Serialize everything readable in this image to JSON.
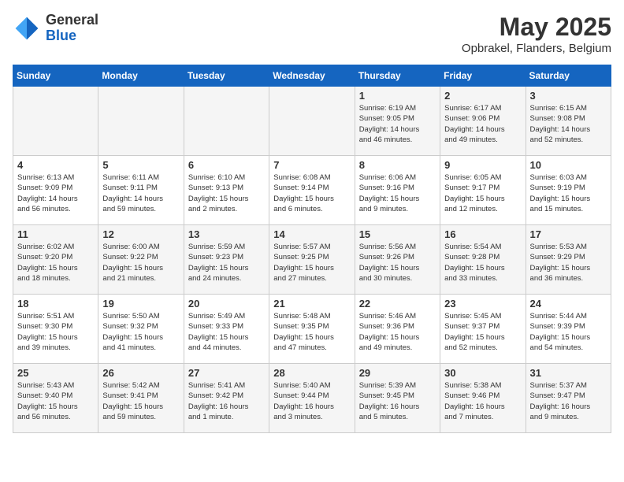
{
  "header": {
    "logo_line1": "General",
    "logo_line2": "Blue",
    "month": "May 2025",
    "location": "Opbrakel, Flanders, Belgium"
  },
  "weekdays": [
    "Sunday",
    "Monday",
    "Tuesday",
    "Wednesday",
    "Thursday",
    "Friday",
    "Saturday"
  ],
  "weeks": [
    [
      {
        "day": "",
        "info": ""
      },
      {
        "day": "",
        "info": ""
      },
      {
        "day": "",
        "info": ""
      },
      {
        "day": "",
        "info": ""
      },
      {
        "day": "1",
        "info": "Sunrise: 6:19 AM\nSunset: 9:05 PM\nDaylight: 14 hours\nand 46 minutes."
      },
      {
        "day": "2",
        "info": "Sunrise: 6:17 AM\nSunset: 9:06 PM\nDaylight: 14 hours\nand 49 minutes."
      },
      {
        "day": "3",
        "info": "Sunrise: 6:15 AM\nSunset: 9:08 PM\nDaylight: 14 hours\nand 52 minutes."
      }
    ],
    [
      {
        "day": "4",
        "info": "Sunrise: 6:13 AM\nSunset: 9:09 PM\nDaylight: 14 hours\nand 56 minutes."
      },
      {
        "day": "5",
        "info": "Sunrise: 6:11 AM\nSunset: 9:11 PM\nDaylight: 14 hours\nand 59 minutes."
      },
      {
        "day": "6",
        "info": "Sunrise: 6:10 AM\nSunset: 9:13 PM\nDaylight: 15 hours\nand 2 minutes."
      },
      {
        "day": "7",
        "info": "Sunrise: 6:08 AM\nSunset: 9:14 PM\nDaylight: 15 hours\nand 6 minutes."
      },
      {
        "day": "8",
        "info": "Sunrise: 6:06 AM\nSunset: 9:16 PM\nDaylight: 15 hours\nand 9 minutes."
      },
      {
        "day": "9",
        "info": "Sunrise: 6:05 AM\nSunset: 9:17 PM\nDaylight: 15 hours\nand 12 minutes."
      },
      {
        "day": "10",
        "info": "Sunrise: 6:03 AM\nSunset: 9:19 PM\nDaylight: 15 hours\nand 15 minutes."
      }
    ],
    [
      {
        "day": "11",
        "info": "Sunrise: 6:02 AM\nSunset: 9:20 PM\nDaylight: 15 hours\nand 18 minutes."
      },
      {
        "day": "12",
        "info": "Sunrise: 6:00 AM\nSunset: 9:22 PM\nDaylight: 15 hours\nand 21 minutes."
      },
      {
        "day": "13",
        "info": "Sunrise: 5:59 AM\nSunset: 9:23 PM\nDaylight: 15 hours\nand 24 minutes."
      },
      {
        "day": "14",
        "info": "Sunrise: 5:57 AM\nSunset: 9:25 PM\nDaylight: 15 hours\nand 27 minutes."
      },
      {
        "day": "15",
        "info": "Sunrise: 5:56 AM\nSunset: 9:26 PM\nDaylight: 15 hours\nand 30 minutes."
      },
      {
        "day": "16",
        "info": "Sunrise: 5:54 AM\nSunset: 9:28 PM\nDaylight: 15 hours\nand 33 minutes."
      },
      {
        "day": "17",
        "info": "Sunrise: 5:53 AM\nSunset: 9:29 PM\nDaylight: 15 hours\nand 36 minutes."
      }
    ],
    [
      {
        "day": "18",
        "info": "Sunrise: 5:51 AM\nSunset: 9:30 PM\nDaylight: 15 hours\nand 39 minutes."
      },
      {
        "day": "19",
        "info": "Sunrise: 5:50 AM\nSunset: 9:32 PM\nDaylight: 15 hours\nand 41 minutes."
      },
      {
        "day": "20",
        "info": "Sunrise: 5:49 AM\nSunset: 9:33 PM\nDaylight: 15 hours\nand 44 minutes."
      },
      {
        "day": "21",
        "info": "Sunrise: 5:48 AM\nSunset: 9:35 PM\nDaylight: 15 hours\nand 47 minutes."
      },
      {
        "day": "22",
        "info": "Sunrise: 5:46 AM\nSunset: 9:36 PM\nDaylight: 15 hours\nand 49 minutes."
      },
      {
        "day": "23",
        "info": "Sunrise: 5:45 AM\nSunset: 9:37 PM\nDaylight: 15 hours\nand 52 minutes."
      },
      {
        "day": "24",
        "info": "Sunrise: 5:44 AM\nSunset: 9:39 PM\nDaylight: 15 hours\nand 54 minutes."
      }
    ],
    [
      {
        "day": "25",
        "info": "Sunrise: 5:43 AM\nSunset: 9:40 PM\nDaylight: 15 hours\nand 56 minutes."
      },
      {
        "day": "26",
        "info": "Sunrise: 5:42 AM\nSunset: 9:41 PM\nDaylight: 15 hours\nand 59 minutes."
      },
      {
        "day": "27",
        "info": "Sunrise: 5:41 AM\nSunset: 9:42 PM\nDaylight: 16 hours\nand 1 minute."
      },
      {
        "day": "28",
        "info": "Sunrise: 5:40 AM\nSunset: 9:44 PM\nDaylight: 16 hours\nand 3 minutes."
      },
      {
        "day": "29",
        "info": "Sunrise: 5:39 AM\nSunset: 9:45 PM\nDaylight: 16 hours\nand 5 minutes."
      },
      {
        "day": "30",
        "info": "Sunrise: 5:38 AM\nSunset: 9:46 PM\nDaylight: 16 hours\nand 7 minutes."
      },
      {
        "day": "31",
        "info": "Sunrise: 5:37 AM\nSunset: 9:47 PM\nDaylight: 16 hours\nand 9 minutes."
      }
    ]
  ]
}
